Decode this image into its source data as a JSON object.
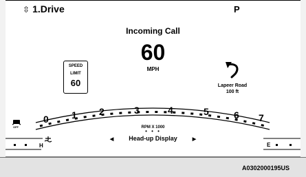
{
  "header": {
    "gear_selector_arrows": "⇳",
    "gear_selector_label": "1.Drive",
    "gear": "P"
  },
  "notification": "Incoming Call",
  "speedometer": {
    "value": "60",
    "unit": "MPH"
  },
  "speed_limit_sign": {
    "line1": "SPEED",
    "line2": "LIMIT",
    "value": "60"
  },
  "navigation": {
    "turn_icon": "turn-left-arrow",
    "street": "Lapeer Road",
    "distance": "100 ft"
  },
  "tachometer": {
    "ticks": [
      "0",
      "1",
      "2",
      "3",
      "4",
      "5",
      "6",
      "7"
    ],
    "unit_label": "RPM X 1000",
    "dots": "• • •"
  },
  "menu": {
    "left_arrow": "◀",
    "label": "Head-up Display",
    "right_arrow": "▶"
  },
  "temp_gauge": {
    "label": "H"
  },
  "fuel_gauge": {
    "label": "E"
  },
  "footer_code": "A0302000195US",
  "colors": {
    "background": "#ffffff",
    "foreground": "#000000",
    "bottom_band": "#e4e4e4"
  }
}
